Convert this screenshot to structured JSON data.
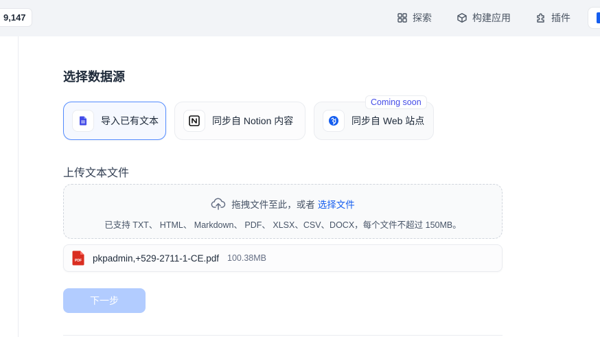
{
  "topbar": {
    "stars": "9,147",
    "nav": [
      {
        "label": "探索",
        "icon": "grid-icon"
      },
      {
        "label": "构建应用",
        "icon": "cube-icon"
      },
      {
        "label": "插件",
        "icon": "puzzle-icon"
      }
    ]
  },
  "page": {
    "title": "选择数据源",
    "sources": [
      {
        "label": "导入已有文本",
        "icon": "document-icon",
        "active": true
      },
      {
        "label": "同步自 Notion 内容",
        "icon": "notion-icon",
        "active": false
      },
      {
        "label": "同步自 Web 站点",
        "icon": "web-icon",
        "active": false,
        "badge": "Coming soon"
      }
    ],
    "upload_title": "上传文本文件",
    "dropzone": {
      "prompt": "拖拽文件至此，或者",
      "link": "选择文件",
      "hint": "已支持 TXT、 HTML、 Markdown、 PDF、 XLSX、CSV、DOCX，每个文件不超过 150MB。"
    },
    "file": {
      "name": "pkpadmin,+529-2711-1-CE.pdf",
      "size": "100.38MB",
      "icon_text": "PDF"
    },
    "next_label": "下一步"
  },
  "colors": {
    "accent": "#155eef",
    "active_border": "#528bff",
    "disabled_button": "#b2ccff",
    "pdf_red": "#d92d20"
  }
}
